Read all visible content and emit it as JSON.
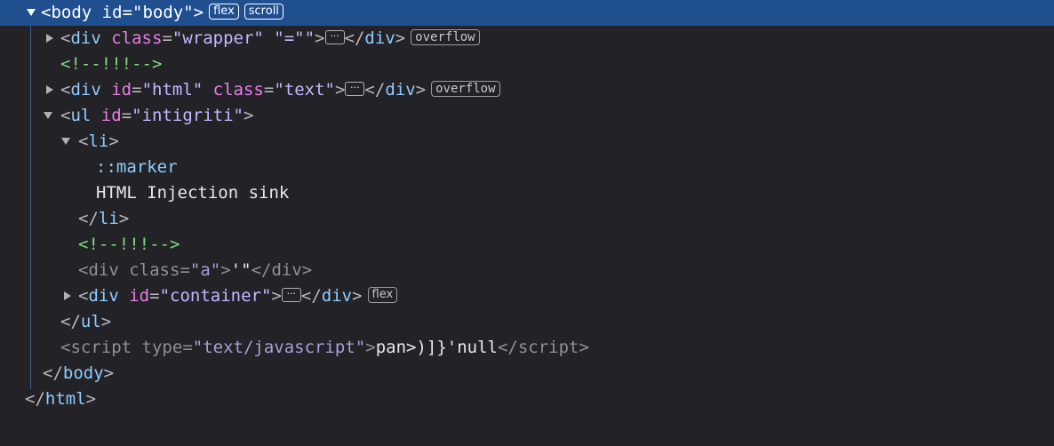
{
  "colors": {
    "background": "#232327",
    "selected_row": "#1f4f8f",
    "tag": "#8ecbff",
    "attribute": "#ea7be8",
    "value": "#c4b6ff",
    "comment": "#7fd77f"
  },
  "icons": [
    "expand-triangle-icon",
    "collapse-triangle-icon",
    "ellipsis-icon"
  ],
  "nodes": {
    "body": {
      "tag": "body",
      "attr": "id",
      "val": "\"body\"",
      "badges": [
        "flex",
        "scroll"
      ]
    },
    "wrapper": {
      "tag": "div",
      "attr": "class",
      "val": "\"wrapper\"",
      "extra_attr": " \"=\"\"",
      "close": "div",
      "badge": "overflow"
    },
    "comment1": "<!--!!!-->",
    "html_div": {
      "tag": "div",
      "attr": "id",
      "val": "\"html\"",
      "attr2": "class",
      "val2": "\"text\"",
      "close": "div",
      "badge": "overflow"
    },
    "ul": {
      "tag": "ul",
      "attr": "id",
      "val": "\"intigriti\""
    },
    "li": {
      "tag": "li"
    },
    "marker": "::marker",
    "li_text": "HTML Injection sink",
    "li_close": "li",
    "comment2": "<!--!!!-->",
    "div_a": {
      "tag": "div",
      "attr": "class",
      "val": "\"a\"",
      "text": "'\"",
      "close": "div"
    },
    "container": {
      "tag": "div",
      "attr": "id",
      "val": "\"container\"",
      "close": "div",
      "badge": "flex"
    },
    "ul_close": "ul",
    "script": {
      "tag": "script",
      "attr": "type",
      "val": "\"text/javascript\"",
      "text": "pan>)]}'null",
      "close": "script"
    },
    "body_close": "body",
    "html_close": "html"
  }
}
